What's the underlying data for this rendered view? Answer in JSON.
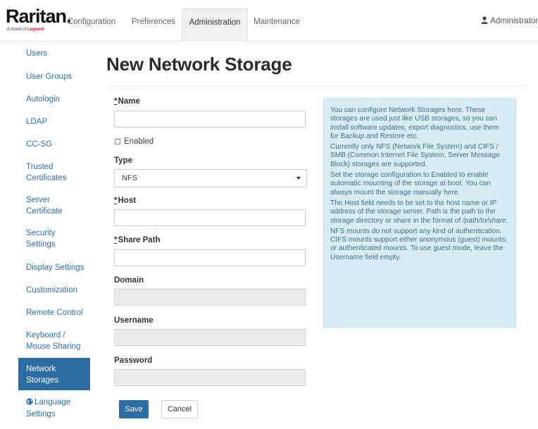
{
  "header": {
    "logo_text": "Raritan.",
    "logo_tagline_prefix": "A brand of ",
    "logo_tagline_brand": "Legrand",
    "tabs": [
      {
        "label": "Configuration"
      },
      {
        "label": "Preferences"
      },
      {
        "label": "Administration",
        "active": true
      },
      {
        "label": "Maintenance"
      }
    ],
    "user_label": "Administrator",
    "user_icon": "person-icon"
  },
  "sidebar": {
    "items": [
      {
        "label": "Users"
      },
      {
        "label": "User Groups"
      },
      {
        "label": "Autologin"
      },
      {
        "label": "LDAP"
      },
      {
        "label": "CC-SG"
      },
      {
        "label_line1": "Trusted",
        "label_line2": "Certificates"
      },
      {
        "label_line1": "Server",
        "label_line2": "Certificate"
      },
      {
        "label_line1": "Security",
        "label_line2": "Settings"
      },
      {
        "label": "Display Settings"
      },
      {
        "label": "Customization"
      },
      {
        "label": "Remote Control"
      },
      {
        "label_line1": "Keyboard /",
        "label_line2": "Mouse Sharing"
      },
      {
        "label_line1": "Network",
        "label_line2": "Storages",
        "active": true
      },
      {
        "label_line1": "Language",
        "label_line2": "Settings",
        "icon": "globe-icon"
      }
    ]
  },
  "main": {
    "title": "New Network Storage",
    "required_marker": "*",
    "fields": {
      "name_label": "Name",
      "name_value": "",
      "enabled_label": "Enabled",
      "enabled_checked": false,
      "type_label": "Type",
      "type_value": "NFS",
      "host_label": "Host",
      "host_value": "",
      "share_path_label": "Share Path",
      "share_path_value": "",
      "domain_label": "Domain",
      "domain_value": "",
      "username_label": "Username",
      "username_value": "",
      "password_label": "Password",
      "password_value": ""
    },
    "buttons": {
      "save": "Save",
      "cancel": "Cancel"
    }
  },
  "help": {
    "p1": "You can configure Network Storages here. These storages are used just like USB storages, so you can install software updates, export diagnostics, use them for Backup and Restore etc.",
    "p2": "Currently only NFS (Network File System) and CIFS / SMB (Common Internet File System, Server Message Block) storages are supported.",
    "p3": "Set the storage configuration to Enabled to enable automatic mounting of the storage at boot. You can always mount the storage manually here.",
    "p4_a": "The Host field needs to be set to the host name or IP address of the storage server. Path is the path to the storage directory or share in the format of ",
    "p4_path": "/path/to/share",
    "p4_b": ".",
    "p5": "NFS mounts do not support any kind of authentication. CIFS mounts support either anonymous (guest) mounts, or authenticated mounts. To use guest mode, leave the Username field empty."
  },
  "colors": {
    "accent": "#2e6ca4",
    "link": "#2d73b4",
    "help_bg": "#d8ecf5",
    "help_text": "#3f6f87",
    "brand_red": "#d4202a"
  }
}
